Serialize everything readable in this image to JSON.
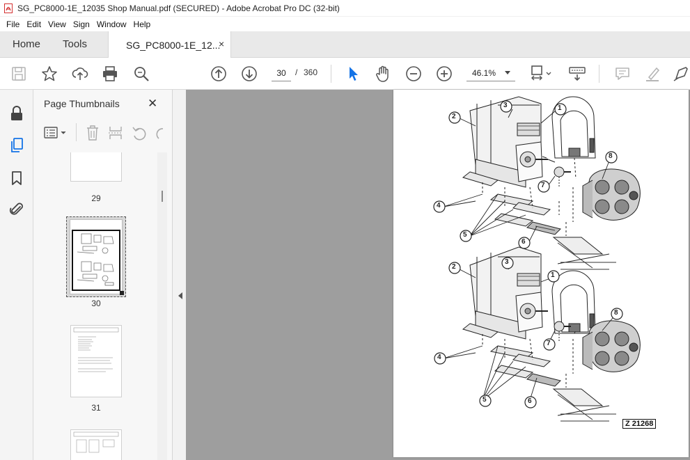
{
  "window": {
    "title": "SG_PC8000-1E_12035 Shop Manual.pdf (SECURED) - Adobe Acrobat Pro DC (32-bit)"
  },
  "menu": [
    "File",
    "Edit",
    "View",
    "Sign",
    "Window",
    "Help"
  ],
  "tabs": {
    "home": "Home",
    "tools": "Tools",
    "document": "SG_PC8000-1E_12...",
    "close": "×"
  },
  "toolbar": {
    "current_page": "30",
    "page_separator": "/",
    "total_pages": "360",
    "zoom": "46.1%",
    "icons": [
      "save-icon",
      "star-icon",
      "upload-icon",
      "print-icon",
      "search-icon",
      "page-up-icon",
      "page-down-icon",
      "select-arrow-icon",
      "hand-icon",
      "zoom-out-icon",
      "zoom-in-icon",
      "fit-page-icon",
      "keyboard-icon",
      "comment-icon",
      "highlight-icon",
      "pen-icon"
    ]
  },
  "thumbnails_panel": {
    "title": "Page Thumbnails",
    "close": "✕",
    "pages": [
      {
        "label": "29"
      },
      {
        "label": "30",
        "selected": true
      },
      {
        "label": "31"
      }
    ]
  },
  "document": {
    "figure_code": "Z 21268",
    "callouts_top": [
      "1",
      "2",
      "3",
      "4",
      "5",
      "6",
      "7",
      "8"
    ],
    "callouts_bottom": [
      "1",
      "2",
      "3",
      "4",
      "5",
      "6",
      "7",
      "8"
    ]
  },
  "colors": {
    "accent": "#1473e6",
    "doc_background": "#9e9e9e",
    "title_icon": "#d32f2f"
  }
}
